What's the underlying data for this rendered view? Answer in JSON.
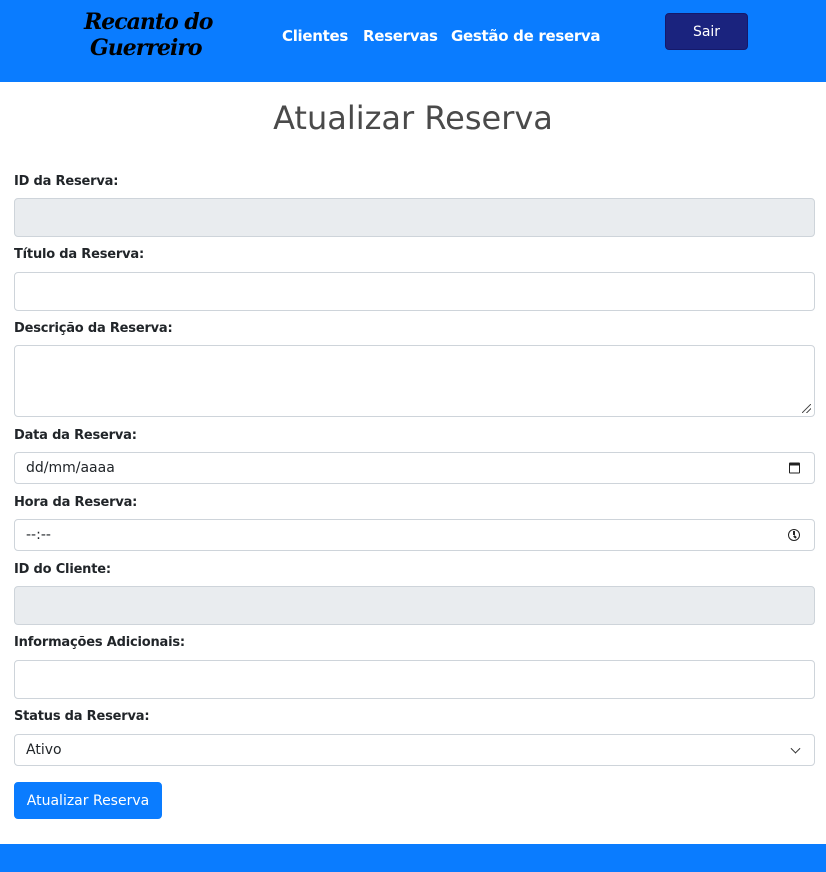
{
  "navbar": {
    "logo_line1": "Recanto do",
    "logo_line2": "Guerreiro",
    "links": [
      "Clientes",
      "Reservas",
      "Gestão de reserva"
    ],
    "logout_label": "Sair"
  },
  "page": {
    "title": "Atualizar Reserva"
  },
  "form": {
    "id_reserva": {
      "label": "ID da Reserva:",
      "value": ""
    },
    "titulo": {
      "label": "Título da Reserva:",
      "value": ""
    },
    "descricao": {
      "label": "Descrição da Reserva:",
      "value": ""
    },
    "data": {
      "label": "Data da Reserva:",
      "placeholder": "dd/mm/aaaa"
    },
    "hora": {
      "label": "Hora da Reserva:",
      "placeholder": "--:--"
    },
    "id_cliente": {
      "label": "ID do Cliente:",
      "value": ""
    },
    "info": {
      "label": "Informações Adicionais:",
      "value": ""
    },
    "status": {
      "label": "Status da Reserva:",
      "selected": "Ativo"
    },
    "submit_label": "Atualizar Reserva"
  },
  "colors": {
    "primary": "#0a7cff",
    "logout": "#1a237e",
    "readonly_field": "#e9ecef"
  },
  "icons": {
    "date": "calendar-icon",
    "time": "clock-icon",
    "select": "chevron-down-icon"
  }
}
